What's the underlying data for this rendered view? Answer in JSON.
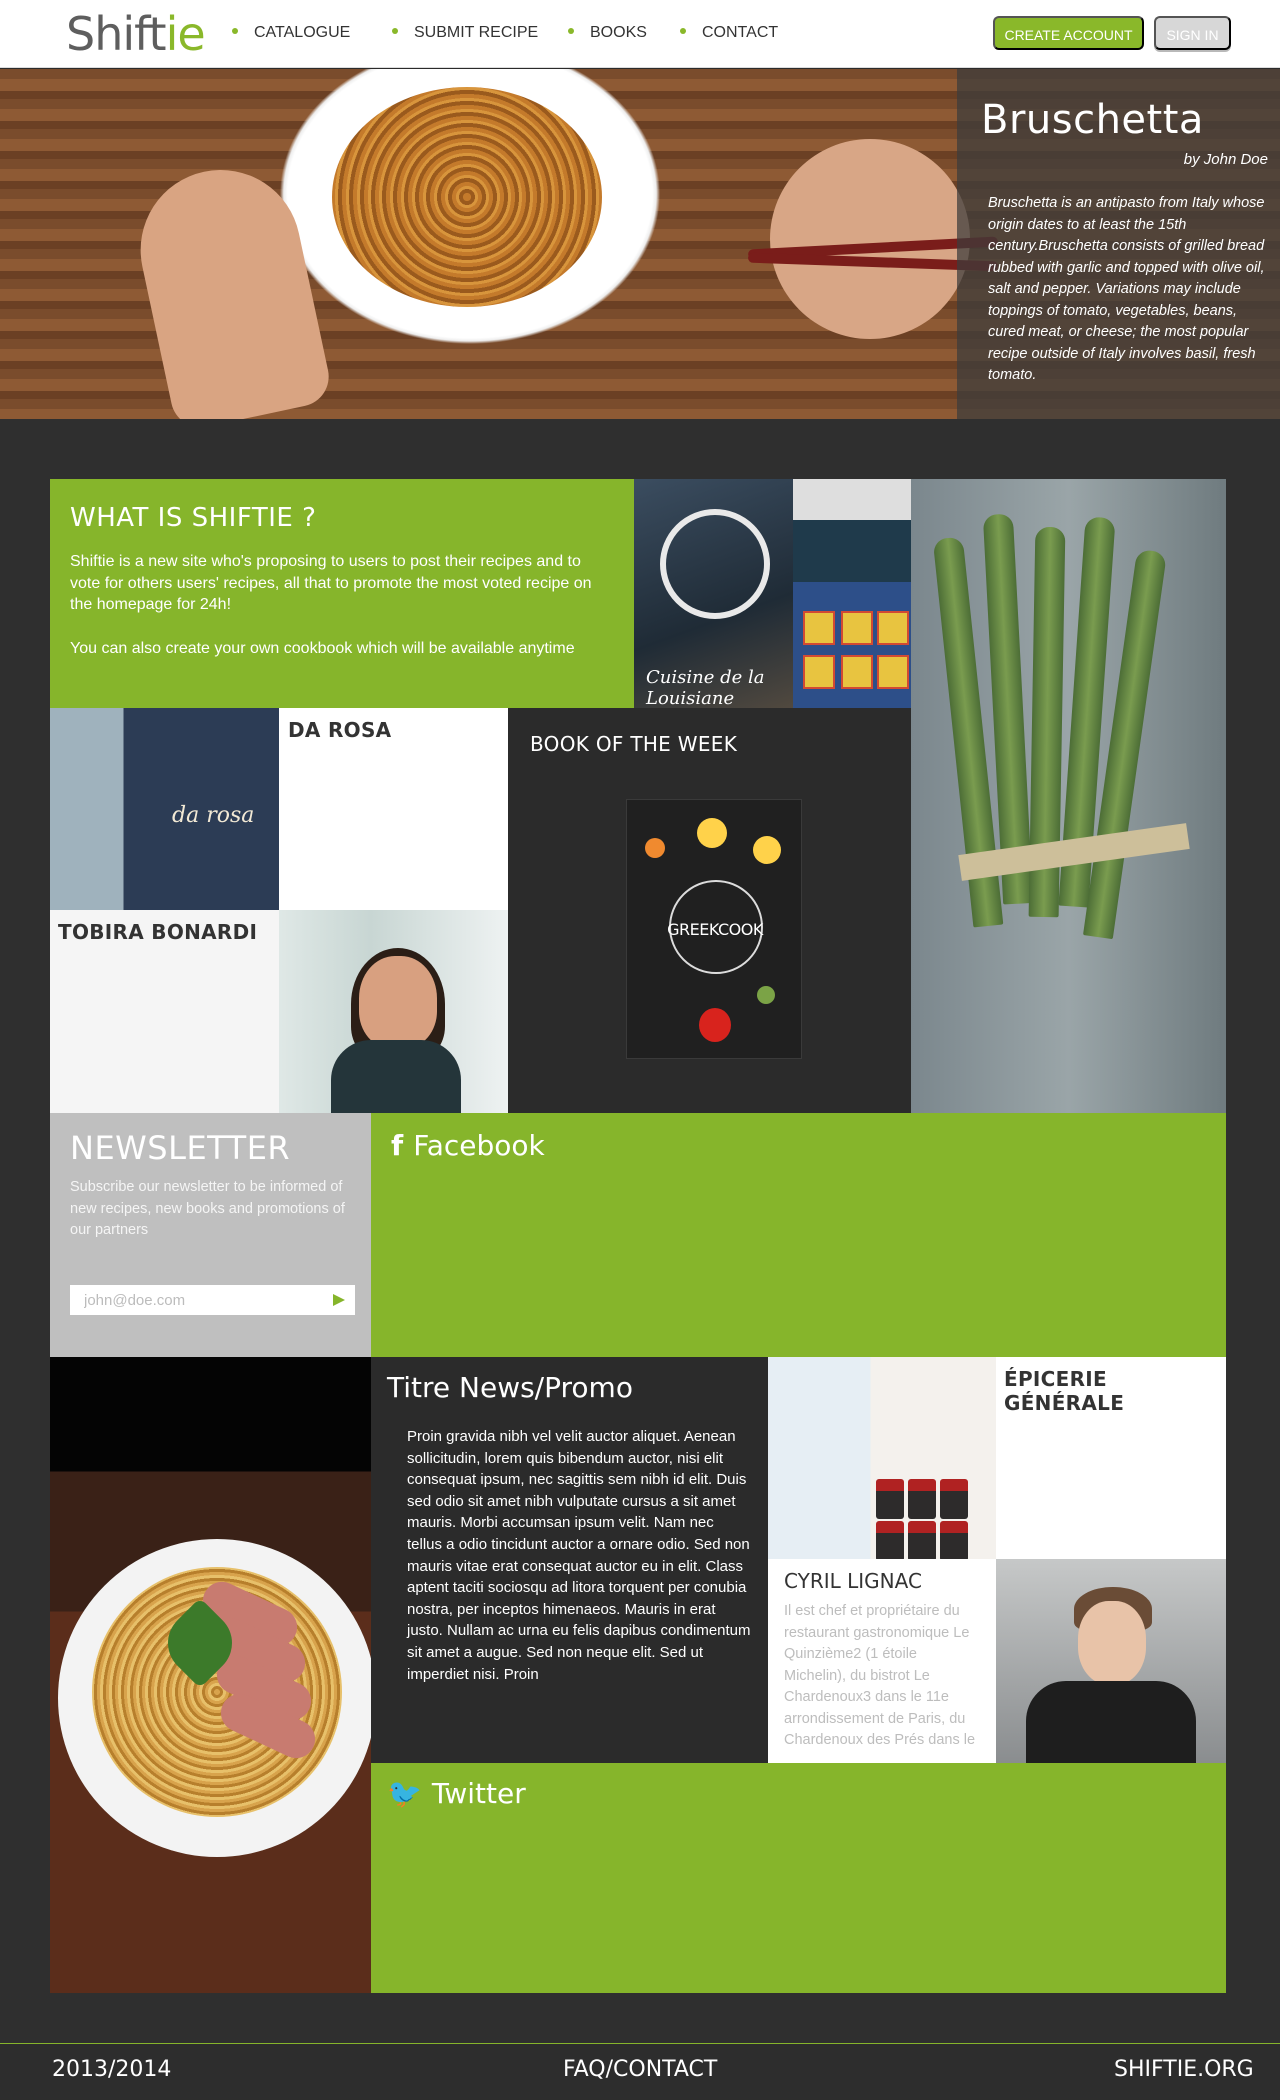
{
  "header": {
    "logo_main": "Shift",
    "logo_accent": "ie",
    "nav": [
      {
        "label": "CATALOGUE"
      },
      {
        "label": "SUBMIT RECIPE"
      },
      {
        "label": "BOOKS"
      },
      {
        "label": "CONTACT"
      }
    ],
    "create_account": "CREATE ACCOUNT",
    "sign_in": "SIGN IN"
  },
  "hero": {
    "title": "Bruschetta",
    "author": "by John Doe",
    "description": "Bruschetta is an antipasto from Italy whose origin dates to at least the 15th century.Bruschetta consists of grilled bread rubbed with garlic and topped with olive oil, salt and pepper. Variations may include toppings of tomato, vegetables, beans, cured meat, or cheese; the most popular recipe outside of Italy involves basil, fresh tomato."
  },
  "what_is": {
    "title": "WHAT IS SHIFTIE ?",
    "paragraph_1": "Shiftie is a new site who's proposing to users to post their recipes and to vote for others users' recipes, all that to promote the most voted recipe on the homepage for 24h!",
    "paragraph_2": "You can also create your own cookbook which will be available anytime"
  },
  "storefront": {
    "sign_text": "Cuisine de la Louisiane"
  },
  "da_rosa": {
    "title": "DA ROSA",
    "sign_text": "da rosa"
  },
  "book_of_week": {
    "title": "BOOK OF THE WEEK",
    "cover_title": "GREEKCOOK"
  },
  "tobira": {
    "title": "TOBIRA BONARDI"
  },
  "newsletter": {
    "title": "NEWSLETTER",
    "text": "Subscribe our newsletter to be informed of new recipes, new books and promotions of our partners",
    "placeholder": "john@doe.com"
  },
  "facebook": {
    "icon": "facebook-icon",
    "title": "Facebook"
  },
  "news_promo": {
    "title": "Titre News/Promo",
    "text": "Proin gravida nibh vel velit auctor aliquet. Aenean sollicitudin, lorem quis bibendum auctor, nisi elit consequat ipsum, nec sagittis sem nibh id elit. Duis sed odio sit amet nibh vulputate cursus a sit amet mauris. Morbi accumsan ipsum velit. Nam nec tellus a odio tincidunt auctor a ornare odio. Sed non mauris vitae erat consequat auctor eu in elit. Class aptent taciti sociosqu ad litora torquent per conubia nostra, per inceptos himenaeos. Mauris in erat justo. Nullam ac urna eu felis dapibus condimentum sit amet a augue. Sed non neque elit. Sed ut imperdiet nisi. Proin"
  },
  "epicerie": {
    "title": "ÉPICERIE GÉNÉRALE"
  },
  "cyril": {
    "title": "CYRIL LIGNAC",
    "text": "Il est chef et propriétaire du restaurant gastronomique Le Quinzième2 (1 étoile Michelin), du bistrot Le Chardenoux3 dans le 11e arrondissement de Paris, du Chardenoux des Prés dans le"
  },
  "twitter": {
    "icon": "twitter-icon",
    "title": "Twitter"
  },
  "footer": {
    "years": "2013/2014",
    "faq": "FAQ/CONTACT",
    "site": "SHIFTIE.ORG"
  },
  "colors": {
    "accent": "#86b52b",
    "dark": "#2b2b2b",
    "light_gray": "#bfbfbf"
  }
}
